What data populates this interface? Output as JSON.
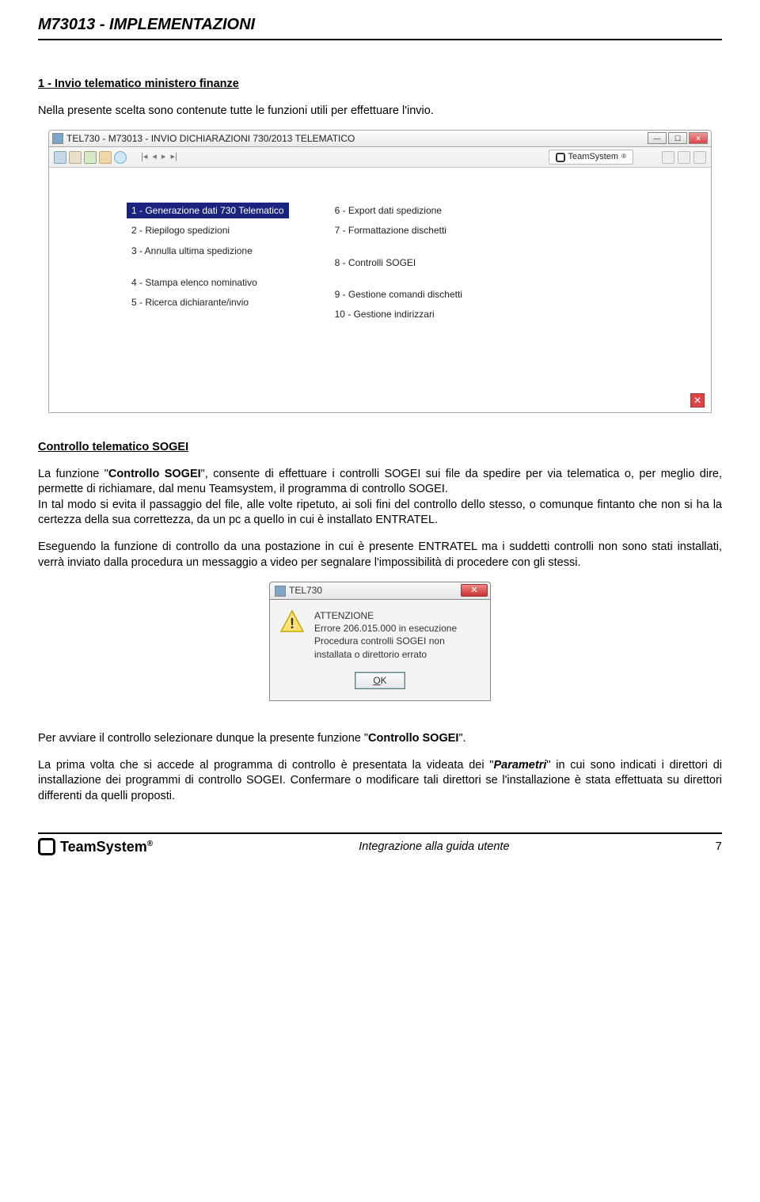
{
  "doc_title": "M73013 - IMPLEMENTAZIONI",
  "section1_title": "1 - Invio telematico ministero finanze",
  "section1_intro": "Nella presente scelta sono contenute tutte le funzioni utili per effettuare l'invio.",
  "app": {
    "title": "TEL730 - M73013 - INVIO DICHIARAZIONI 730/2013 TELEMATICO",
    "brand": "TeamSystem",
    "menu_left": [
      "1 - Generazione dati 730 Telematico",
      "2 - Riepilogo spedizioni",
      "3 - Annulla ultima spedizione",
      "4 - Stampa elenco nominativo",
      "5 - Ricerca dichiarante/invio"
    ],
    "menu_right": [
      "6 - Export dati spedizione",
      "7 - Formattazione dischetti",
      "8 - Controlli SOGEI",
      "9 - Gestione comandi dischetti",
      "10 - Gestione indirizzari"
    ]
  },
  "section2_title": "Controllo telematico SOGEI",
  "section2_p1_a": "La funzione \"",
  "section2_p1_b": "Controllo SOGEI",
  "section2_p1_c": "\", consente di effettuare i controlli SOGEI sui file da spedire per via telematica o, per meglio dire, permette di richiamare, dal menu Teamsystem, il programma di controllo SOGEI.",
  "section2_p1_d": "In tal modo si evita il passaggio del file, alle volte ripetuto, ai soli fini del controllo dello stesso, o comunque fintanto che non si ha la certezza della sua correttezza, da un pc a quello in cui è installato ENTRATEL.",
  "section2_p2": "Eseguendo la funzione di controllo da una postazione in cui è presente ENTRATEL ma i suddetti controlli non sono stati installati, verrà inviato dalla procedura un messaggio a video per segnalare l'impossibilità di procedere con gli stessi.",
  "dialog": {
    "title": "TEL730",
    "heading": "ATTENZIONE",
    "line1": "Errore 206.015.000 in esecuzione",
    "line2": "Procedura controlli SOGEI non",
    "line3": "installata o direttorio errato",
    "ok_u": "O",
    "ok_rest": "K"
  },
  "section3_p1_a": "Per avviare il controllo selezionare dunque la presente funzione \"",
  "section3_p1_b": "Controllo SOGEI",
  "section3_p1_c": "\".",
  "section3_p2_a": "La prima volta che si accede al programma di controllo è presentata la videata dei ",
  "section3_p2_b": "Parametri",
  "section3_p2_c": "\" in cui sono indicati i direttori di installazione dei programmi di controllo SOGEI. Confermare o modificare tali direttori se l'installazione è stata effettuata su direttori differenti da quelli proposti.",
  "footer": {
    "brand": "TeamSystem",
    "center": "Integrazione alla guida utente",
    "page": "7"
  }
}
